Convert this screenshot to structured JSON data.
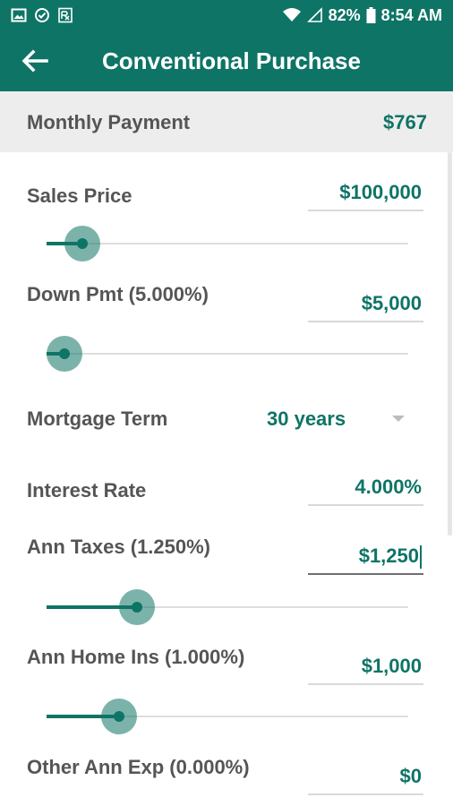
{
  "status_bar": {
    "left_icons": [
      "image-icon",
      "check-circle-icon",
      "rx-icon"
    ],
    "battery": "82%",
    "time": "8:54 AM"
  },
  "header": {
    "title": "Conventional Purchase"
  },
  "summary": {
    "label": "Monthly Payment",
    "value": "$767"
  },
  "fields": {
    "sales_price": {
      "label": "Sales Price",
      "value": "$100,000",
      "slider": 0.1
    },
    "down_pmt": {
      "label": "Down Pmt (5.000%)",
      "value": "$5,000",
      "slider": 0.05
    },
    "mortgage_term": {
      "label": "Mortgage Term",
      "value": "30 years"
    },
    "interest_rate": {
      "label": "Interest Rate",
      "value": "4.000%"
    },
    "ann_taxes": {
      "label": "Ann Taxes (1.250%)",
      "value": "$1,250",
      "slider": 0.25
    },
    "ann_home_ins": {
      "label": "Ann Home Ins (1.000%)",
      "value": "$1,000",
      "slider": 0.2
    },
    "other_ann_exp": {
      "label": "Other Ann Exp (0.000%)",
      "value": "$0"
    }
  },
  "colors": {
    "primary": "#0e7466",
    "label_text": "#555555",
    "summary_bg": "#ededed"
  }
}
